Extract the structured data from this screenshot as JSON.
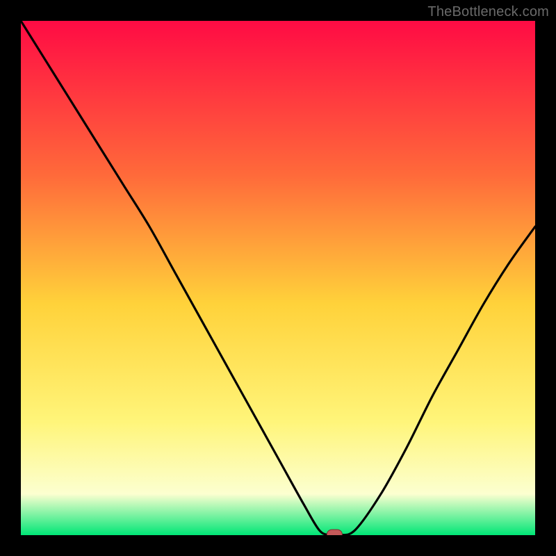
{
  "watermark": "TheBottleneck.com",
  "colors": {
    "black": "#000000",
    "curve": "#000000",
    "marker_fill": "#c55a5a",
    "marker_stroke": "#7a2f2f",
    "grad_top": "#ff0b44",
    "grad_mid1": "#ff6a3a",
    "grad_mid2": "#ffd23a",
    "grad_mid3": "#fff57a",
    "grad_mid4": "#fcffd0",
    "grad_bottom": "#00e676"
  },
  "chart_data": {
    "type": "line",
    "title": "",
    "xlabel": "",
    "ylabel": "",
    "xlim": [
      0,
      100
    ],
    "ylim": [
      0,
      100
    ],
    "series": [
      {
        "name": "bottleneck-curve",
        "x": [
          0,
          5,
          10,
          15,
          20,
          25,
          30,
          35,
          40,
          45,
          50,
          55,
          58,
          60,
          62,
          65,
          70,
          75,
          80,
          85,
          90,
          95,
          100
        ],
        "y": [
          100,
          92,
          84,
          76,
          68,
          60,
          51,
          42,
          33,
          24,
          15,
          6,
          1,
          0,
          0,
          1,
          8,
          17,
          27,
          36,
          45,
          53,
          60
        ]
      }
    ],
    "marker": {
      "x": 61,
      "y": 0
    }
  }
}
